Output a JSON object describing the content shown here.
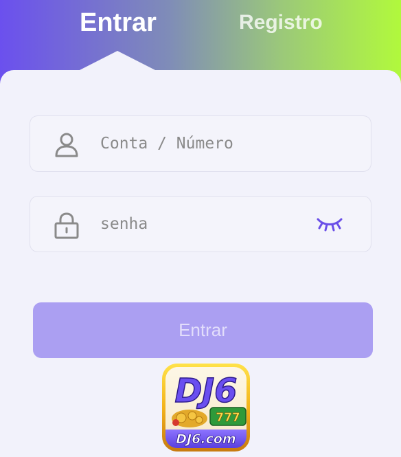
{
  "tabs": {
    "login_label": "Entrar",
    "register_label": "Registro"
  },
  "account_field": {
    "placeholder": "Conta / Número",
    "value": ""
  },
  "password_field": {
    "placeholder": "senha",
    "value": ""
  },
  "submit": {
    "label": "Entrar"
  },
  "logo": {
    "brand": "DJ6",
    "domain": "DJ6.com",
    "slot_number": "777"
  },
  "icons": {
    "account": "user-icon",
    "password": "lock-icon",
    "toggle_visibility": "eye-closed-icon"
  },
  "colors": {
    "accent": "#6b50ee",
    "gradient_end": "#b1f93c",
    "button": "#ab9ff2",
    "icon_gray": "#8a8a8a",
    "eye_icon": "#6a4fe8"
  }
}
